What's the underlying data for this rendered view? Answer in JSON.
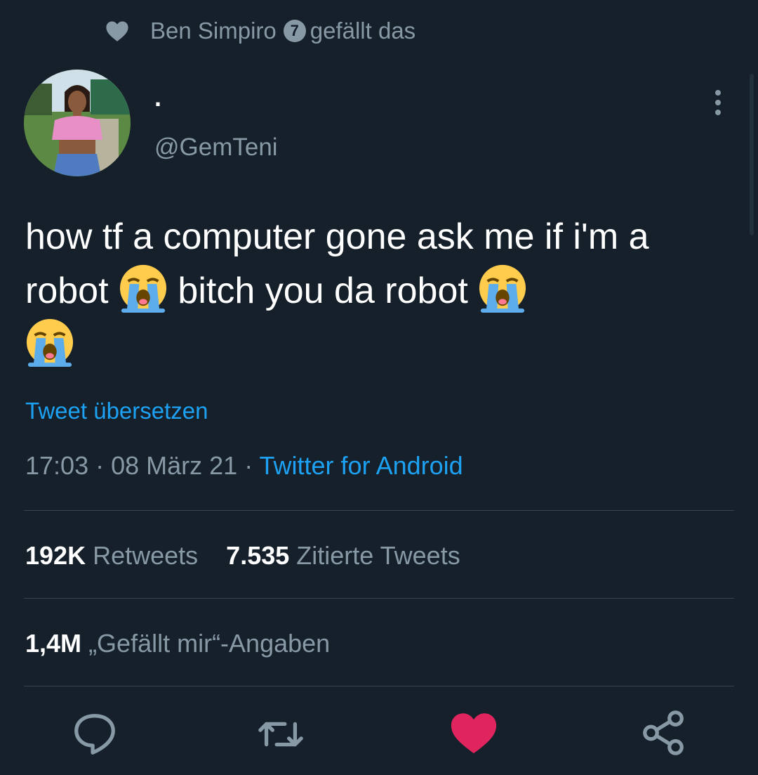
{
  "social_context": {
    "user": "Ben Simpiro",
    "badge": "7",
    "action": "gefällt das"
  },
  "author": {
    "display_name": ".",
    "handle": "@GemTeni"
  },
  "tweet": {
    "text_part1": "how tf a computer gone ask me if i'm a robot ",
    "text_part2": " bitch you da robot ",
    "emoji_name": "loudly-crying-face"
  },
  "translate_label": "Tweet übersetzen",
  "meta": {
    "time": "17:03",
    "separator": " · ",
    "date": "08 März 21",
    "source": "Twitter for Android"
  },
  "stats": {
    "retweets_count": "192K",
    "retweets_label": "Retweets",
    "quotes_count": "7.535",
    "quotes_label": "Zitierte Tweets",
    "likes_count": "1,4M",
    "likes_label": "„Gefällt mir“-Angaben"
  },
  "colors": {
    "background": "#15202b",
    "accent": "#1da1f2",
    "like": "#e0245e",
    "muted": "#8899a6"
  },
  "icons": [
    "heart-icon",
    "more-vertical-icon",
    "reply-icon",
    "retweet-icon",
    "like-icon",
    "share-icon"
  ]
}
